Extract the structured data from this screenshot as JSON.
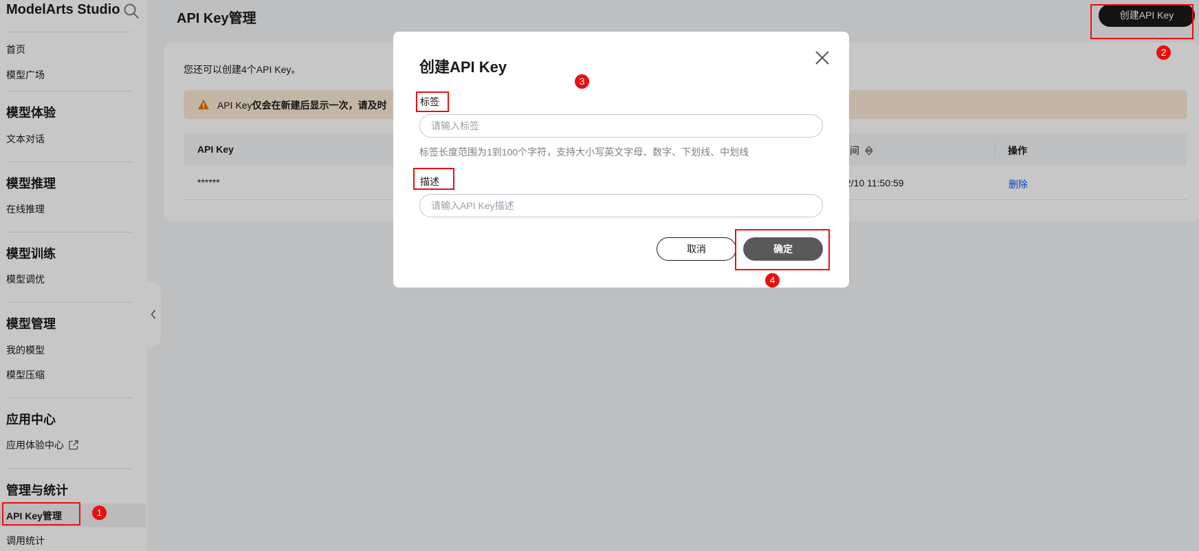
{
  "sidebar": {
    "brand": "ModelArts Studio",
    "items": {
      "home": "首页",
      "model_plaza": "模型广场",
      "section_experience": "模型体验",
      "text_chat": "文本对话",
      "section_inference": "模型推理",
      "online_inference": "在线推理",
      "section_training": "模型训练",
      "model_tuning": "模型调优",
      "section_management": "模型管理",
      "my_models": "我的模型",
      "model_compression": "模型压缩",
      "section_app": "应用中心",
      "app_center": "应用体验中心",
      "section_admin": "管理与统计",
      "api_key_mgmt": "API Key管理",
      "call_stats": "调用统计"
    }
  },
  "header": {
    "title": "API Key管理",
    "create_button": "创建API Key"
  },
  "content": {
    "quota": "您还可以创建4个API Key。",
    "warning_prefix": "API Key",
    "warning_bold": "仅会在新建后显示一次，请及时",
    "table": {
      "col_api_key": "API Key",
      "col_time": "间",
      "col_actions": "操作",
      "rows": [
        {
          "api_key": "******",
          "time": "2/10 11:50:59",
          "action": "删除"
        }
      ]
    }
  },
  "modal": {
    "title": "创建API Key",
    "label_field": "标签",
    "label_placeholder": "请输入标签",
    "label_hint": "标签长度范围为1到100个字符，支持大小写英文字母、数字、下划线、中划线",
    "desc_field": "描述",
    "desc_placeholder": "请输入API Key描述",
    "cancel": "取消",
    "confirm": "确定"
  },
  "annotations": [
    "1",
    "2",
    "3",
    "4"
  ],
  "colors": {
    "accent": "#191919",
    "link": "#0a59f7",
    "warning_bg": "#fce9d7",
    "warning_icon": "#e8730d",
    "annotation": "#e8100f"
  }
}
